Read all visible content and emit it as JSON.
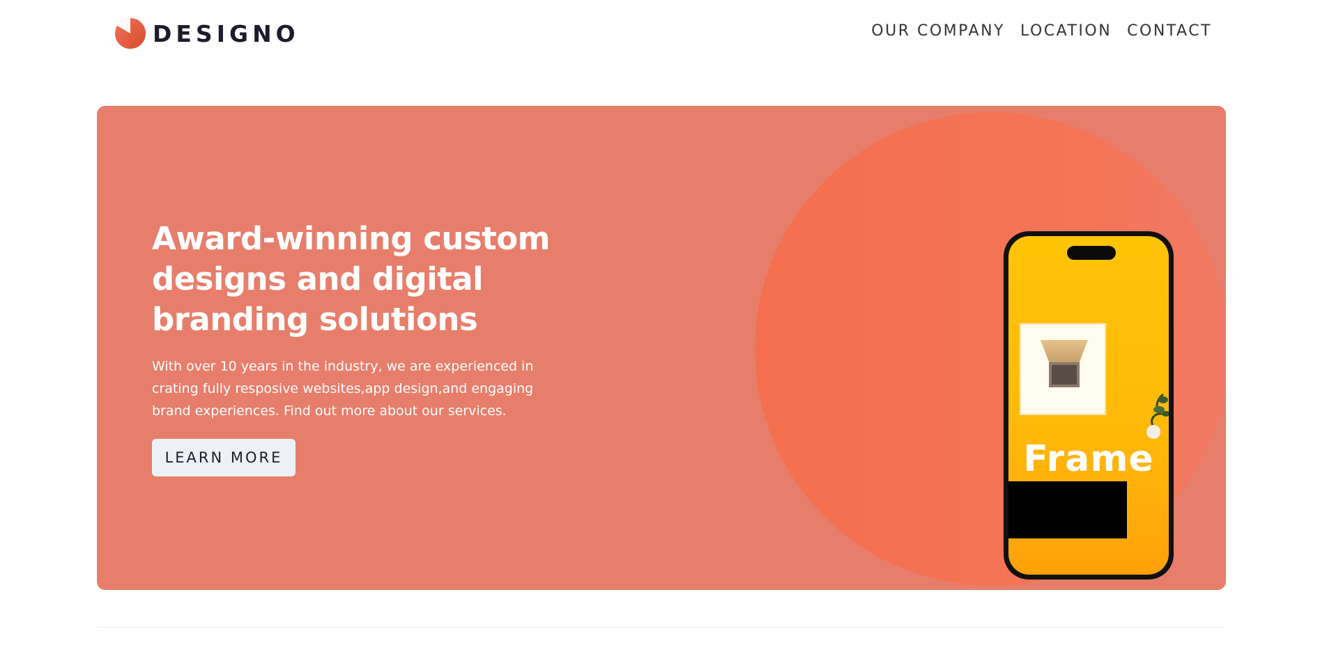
{
  "brand": {
    "name": "DESIGNO",
    "logo_icon": "orange-circle-logo-icon",
    "accent_color": "#f2693f",
    "text_color": "#1d1c2d"
  },
  "nav": {
    "items": [
      {
        "label": "OUR COMPANY"
      },
      {
        "label": "LOCATION"
      },
      {
        "label": "CONTACT"
      }
    ]
  },
  "hero": {
    "title": "Award-winning custom designs and digital branding solutions",
    "description": "With over 10 years in the industry, we are experienced in crating fully resposive websites,app design,and engaging brand experiences. Find out more about our services.",
    "cta_label": "LEARN MORE",
    "background_color": "#e77e6b",
    "circle_color": "#f46f4d",
    "phone_image_label": "Frame"
  }
}
